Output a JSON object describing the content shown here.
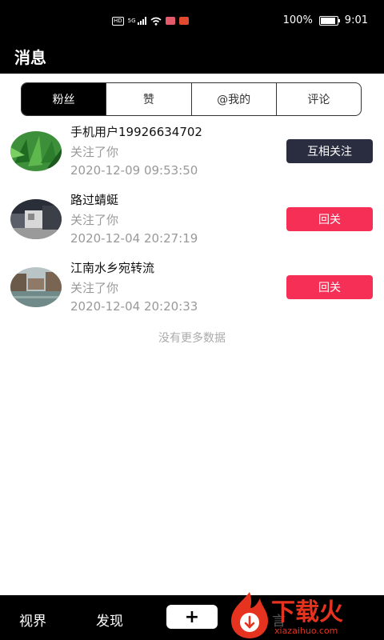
{
  "status_bar": {
    "network_badge": "HD",
    "network_gen": "5G",
    "battery": "100%",
    "time": "9:01"
  },
  "header": {
    "title": "消息"
  },
  "tabs": [
    {
      "label": "粉丝",
      "active": true
    },
    {
      "label": "赞",
      "active": false
    },
    {
      "label": "@我的",
      "active": false
    },
    {
      "label": "评论",
      "active": false
    }
  ],
  "notifications": [
    {
      "name": "手机用户19926634702",
      "action": "关注了你",
      "time": "2020-12-09 09:53:50",
      "button": "互相关注",
      "button_color": "#2a2d40",
      "avatar": "green-leaves-photo"
    },
    {
      "name": "路过蜻蜓",
      "action": "关注了你",
      "time": "2020-12-04 20:27:19",
      "button": "回关",
      "button_color": "#f52f55",
      "avatar": "building-photo"
    },
    {
      "name": "江南水乡宛转流",
      "action": "关注了你",
      "time": "2020-12-04 20:20:33",
      "button": "回关",
      "button_color": "#f52f55",
      "avatar": "water-town-photo"
    }
  ],
  "list_footer": "没有更多数据",
  "bottom_nav": {
    "items": [
      {
        "label": "视界"
      },
      {
        "label": "发现"
      }
    ],
    "add_label": "+",
    "partial_label": "言"
  },
  "watermark": {
    "text": "下载火",
    "domain": "xiazaihuo.com"
  },
  "colors": {
    "accent": "#f52f55",
    "dark_button": "#2a2d40",
    "watermark": "#e53320"
  }
}
